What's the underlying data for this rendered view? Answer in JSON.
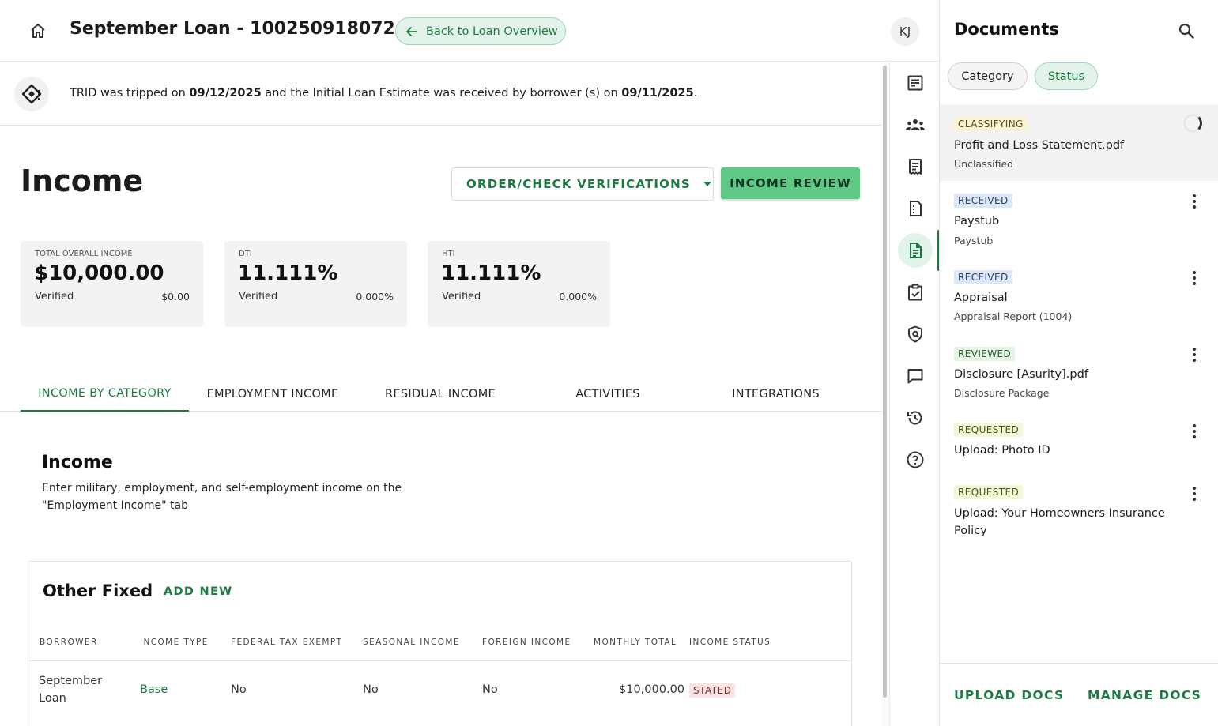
{
  "header": {
    "loan_title": "September Loan - 100250918072",
    "back_button": "Back to Loan Overview",
    "avatar_initials": "KJ"
  },
  "trid": {
    "prefix": "TRID was tripped on ",
    "tripped_date": "09/12/2025",
    "middle": " and the Initial Loan Estimate was received by borrower (s) on ",
    "received_date": "09/11/2025",
    "suffix": "."
  },
  "page": {
    "heading": "Income",
    "order_button": "ORDER/CHECK VERIFICATIONS",
    "review_button": "INCOME REVIEW"
  },
  "stats": [
    {
      "label": "TOTAL OVERALL INCOME",
      "value": "$10,000.00",
      "sub_label": "Verified",
      "sub_value": "$0.00"
    },
    {
      "label": "DTI",
      "value": "11.111%",
      "sub_label": "Verified",
      "sub_value": "0.000%"
    },
    {
      "label": "HTI",
      "value": "11.111%",
      "sub_label": "Verified",
      "sub_value": "0.000%"
    }
  ],
  "tabs": [
    {
      "label": "INCOME BY CATEGORY",
      "active": true
    },
    {
      "label": "EMPLOYMENT INCOME",
      "active": false
    },
    {
      "label": "RESIDUAL INCOME",
      "active": false
    },
    {
      "label": "ACTIVITIES",
      "active": false
    },
    {
      "label": "INTEGRATIONS",
      "active": false
    }
  ],
  "income_section": {
    "title": "Income",
    "description": "Enter military, employment, and self-employment income on the \"Employment Income\" tab"
  },
  "other_fixed": {
    "title": "Other Fixed",
    "add_new": "ADD NEW",
    "columns": [
      "BORROWER",
      "INCOME TYPE",
      "FEDERAL TAX EXEMPT",
      "SEASONAL INCOME",
      "FOREIGN INCOME",
      "MONTHLY TOTAL",
      "INCOME STATUS"
    ],
    "rows": [
      {
        "borrower_line1": "September",
        "borrower_line2": "Loan",
        "income_type": "Base",
        "federal_tax_exempt": "No",
        "seasonal_income": "No",
        "foreign_income": "No",
        "monthly_total": "$10,000.00",
        "income_status": "STATED"
      }
    ]
  },
  "rail": {
    "items": [
      "summary-icon",
      "borrowers-icon",
      "receipt-icon",
      "loan-terms-icon",
      "document-icon",
      "clipboard-check-icon",
      "shield-icon",
      "chat-icon",
      "history-icon",
      "help-icon"
    ],
    "active_index": 4
  },
  "documents": {
    "title": "Documents",
    "chips": {
      "category": "Category",
      "status": "Status"
    },
    "items": [
      {
        "status": "CLASSIFYING",
        "name": "Profit and Loss Statement.pdf",
        "sub": "Unclassified"
      },
      {
        "status": "RECEIVED",
        "name": "Paystub",
        "sub": "Paystub"
      },
      {
        "status": "RECEIVED",
        "name": "Appraisal",
        "sub": "Appraisal Report (1004)"
      },
      {
        "status": "REVIEWED",
        "name": "Disclosure [Asurity].pdf",
        "sub": "Disclosure Package"
      },
      {
        "status": "REQUESTED",
        "name": "Upload: Photo ID",
        "sub": ""
      },
      {
        "status": "REQUESTED",
        "name": "Upload: Your Homeowners Insurance Policy",
        "sub": ""
      }
    ],
    "footer": {
      "upload": "UPLOAD DOCS",
      "manage": "MANAGE DOCS"
    }
  },
  "colors": {
    "accent_green": "#1e7a44",
    "primary_button": "#5dc985",
    "chip_green_bg": "#e2f4e9"
  }
}
